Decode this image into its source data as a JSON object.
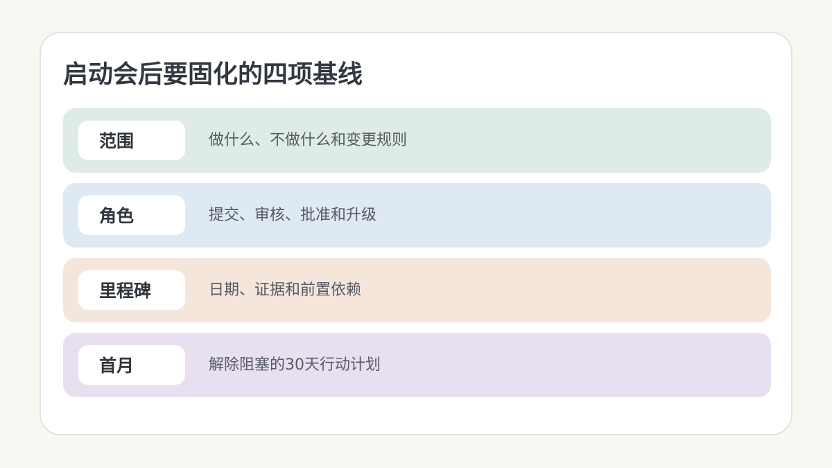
{
  "title": "启动会后要固化的四项基线",
  "rows": [
    {
      "label": "范围",
      "text": "做什么、不做什么和变更规则",
      "color": "#dfece5"
    },
    {
      "label": "角色",
      "text": "提交、审核、批准和升级",
      "color": "#dfe9f3"
    },
    {
      "label": "里程碑",
      "text": "日期、证据和前置依赖",
      "color": "#f5e6dc"
    },
    {
      "label": "首月",
      "text": "解除阻塞的30天行动计划",
      "color": "#e8e0f1"
    }
  ]
}
